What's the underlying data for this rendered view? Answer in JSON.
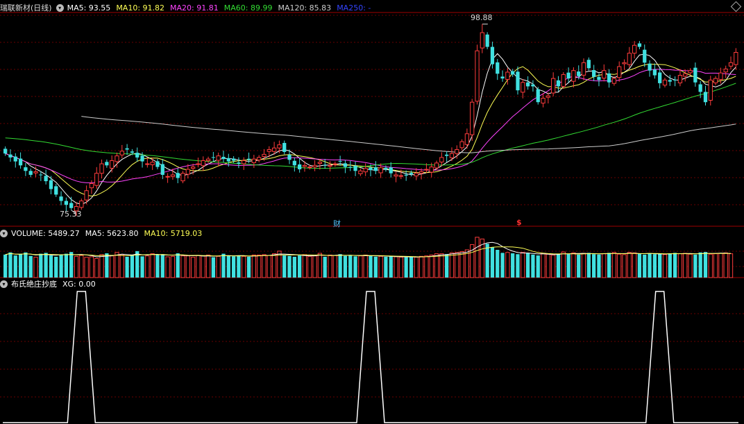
{
  "window": {
    "stock_title": "瑞联新材(日线)"
  },
  "colors": {
    "up": "#ff3c3c",
    "down": "#40e0e0",
    "ma5": "#ffffff",
    "ma10": "#ffff55",
    "ma20": "#ff44ff",
    "ma60": "#33dd33",
    "ma120": "#cccccc",
    "ma250": "#3344ff",
    "grid": "#6a0000",
    "vol_ma5": "#ffffff",
    "vol_ma10": "#ffff55",
    "xg": "#ffffff"
  },
  "price_panel": {
    "ma5": "MA5: 93.55",
    "ma10": "MA10: 91.82",
    "ma20": "MA20: 91.81",
    "ma60": "MA60: 89.99",
    "ma120": "MA120: 85.83",
    "ma250": "MA250: -",
    "high_annotation": "98.88",
    "low_annotation": "75.33",
    "event_marker_cai": "财",
    "event_marker_s": "$"
  },
  "volume_panel": {
    "volume": "VOLUME: 5489.27",
    "ma5": "MA5: 5623.80",
    "ma10": "MA10: 5719.03"
  },
  "indicator_panel": {
    "name": "布氏绝庄抄底",
    "xg": "XG: 0.00"
  },
  "chart_data": {
    "type": "candlestick",
    "price_range": [
      74.0,
      100.0
    ],
    "high": 98.88,
    "low": 75.33,
    "closes": [
      82.5,
      82.0,
      81.5,
      81.0,
      80.3,
      79.8,
      80.2,
      79.8,
      79.0,
      78.0,
      77.3,
      76.5,
      76.0,
      75.6,
      75.8,
      76.5,
      77.8,
      78.7,
      80.0,
      81.2,
      81.0,
      81.6,
      82.2,
      82.8,
      83.0,
      82.6,
      82.0,
      81.5,
      81.2,
      81.4,
      80.8,
      79.8,
      79.6,
      79.8,
      79.4,
      80.0,
      80.5,
      80.8,
      81.2,
      81.6,
      81.8,
      82.0,
      82.2,
      81.8,
      81.5,
      81.6,
      81.2,
      81.6,
      81.7,
      81.8,
      82.0,
      82.4,
      83.0,
      83.2,
      83.6,
      82.7,
      81.7,
      81.0,
      80.5,
      81.0,
      80.8,
      81.0,
      81.4,
      81.0,
      81.0,
      81.2,
      81.5,
      80.8,
      80.7,
      80.3,
      80.3,
      80.6,
      80.4,
      80.3,
      80.7,
      80.5,
      80.0,
      79.8,
      79.7,
      79.7,
      79.9,
      80.0,
      80.2,
      80.5,
      80.8,
      81.3,
      82.0,
      82.2,
      82.5,
      83.0,
      84.0,
      85.0,
      89.0,
      95.5,
      97.8,
      96.0,
      93.8,
      92.6,
      92.0,
      92.8,
      92.5,
      90.5,
      91.5,
      91.0,
      91.0,
      89.0,
      89.5,
      89.8,
      92.0,
      91.0,
      92.5,
      92.0,
      93.0,
      92.3,
      94.0,
      93.3,
      92.2,
      91.8,
      93.0,
      91.5,
      92.0,
      93.5,
      94.0,
      95.2,
      96.2,
      96.0,
      94.0,
      93.0,
      92.4,
      91.4,
      91.8,
      91.6,
      91.8,
      92.4,
      92.6,
      93.0,
      91.5,
      90.3,
      89.0,
      91.8,
      92.0,
      92.7,
      93.2,
      94.0,
      95.3
    ],
    "volumes": [
      5300,
      5800,
      5100,
      5400,
      5800,
      5000,
      4700,
      5500,
      5700,
      5100,
      4800,
      5300,
      5500,
      5900,
      4900,
      5100,
      4700,
      4800,
      4400,
      5300,
      5600,
      5000,
      5800,
      5300,
      4800,
      5200,
      6100,
      4900,
      5000,
      5500,
      5300,
      5400,
      4800,
      4900,
      5600,
      5000,
      5000,
      4700,
      5100,
      5000,
      5200,
      4700,
      4900,
      5500,
      5100,
      4900,
      5000,
      4900,
      4800,
      5200,
      5200,
      5300,
      5100,
      5500,
      6100,
      5100,
      5000,
      4800,
      5100,
      5300,
      4900,
      5000,
      5600,
      4800,
      5200,
      5100,
      5400,
      5000,
      5100,
      4900,
      5000,
      5200,
      5100,
      4800,
      4900,
      4800,
      4900,
      4800,
      4700,
      4700,
      4800,
      4700,
      4900,
      5000,
      5200,
      5500,
      5500,
      5400,
      5700,
      5800,
      6000,
      6400,
      7600,
      9300,
      8900,
      7800,
      7000,
      6400,
      5700,
      5800,
      5600,
      5400,
      5800,
      5700,
      5300,
      5100,
      5500,
      5400,
      5200,
      5500,
      5900,
      5400,
      5700,
      5300,
      5600,
      5700,
      5400,
      5300,
      5500,
      5700,
      5800,
      5400,
      5300,
      5800,
      5700,
      5500,
      5300,
      5600,
      5400,
      5500,
      5300,
      5600,
      5700,
      5500,
      5600,
      5400,
      5300,
      5800,
      5900,
      5400,
      5500,
      5600,
      5700,
      5500
    ],
    "xg_signals": [
      15,
      72,
      129
    ]
  }
}
